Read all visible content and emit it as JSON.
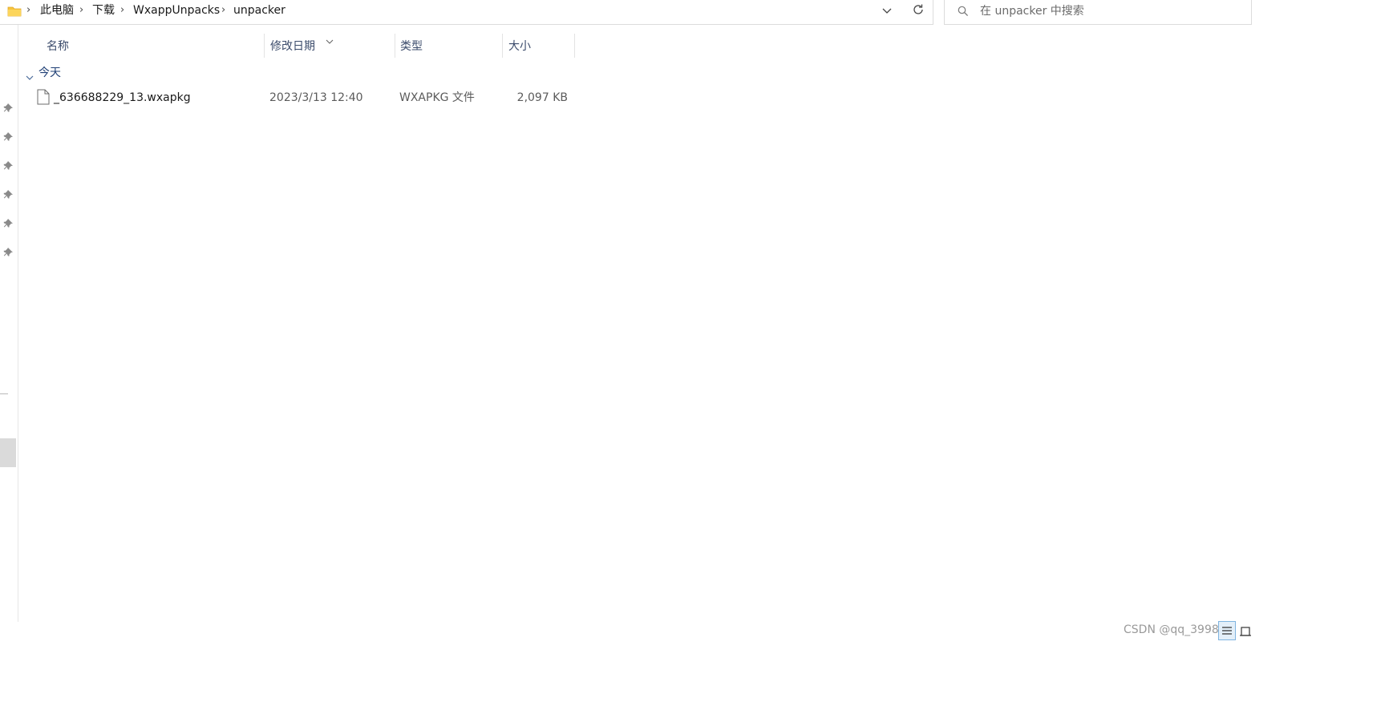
{
  "breadcrumb": {
    "items": [
      "此电脑",
      "下载",
      "WxappUnpacks",
      "unpacker"
    ],
    "separator": "›"
  },
  "search": {
    "placeholder": "在 unpacker 中搜索"
  },
  "columns": {
    "name": "名称",
    "date": "修改日期",
    "type": "类型",
    "size": "大小"
  },
  "groups": [
    {
      "label": "今天",
      "files": [
        {
          "name": "_636688229_13.wxapkg",
          "date": "2023/3/13 12:40",
          "type": "WXAPKG 文件",
          "size": "2,097 KB"
        }
      ]
    }
  ],
  "watermark": "CSDN @qq_3998",
  "colors": {
    "accent": "#1f3f75",
    "folder": "#f8c43c",
    "selection": "#e3eff9"
  },
  "icons": [
    "folder-icon",
    "chevron-right-icon",
    "chevron-down-icon",
    "refresh-icon",
    "search-icon",
    "pin-icon",
    "file-icon",
    "details-view-icon",
    "tiles-view-icon"
  ]
}
